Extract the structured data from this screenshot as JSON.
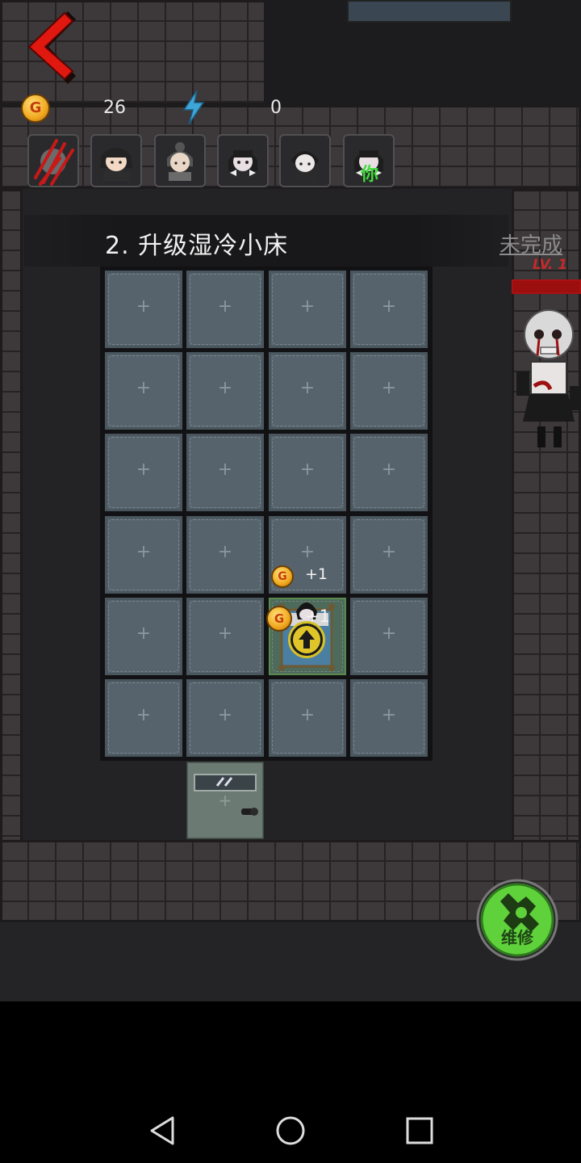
{
  "hud": {
    "coins": "26",
    "energy": "0",
    "coin_symbol": "G"
  },
  "characters": [
    {
      "name": "claw-marks-icon"
    },
    {
      "name": "girl-pigtails-icon"
    },
    {
      "name": "girl-bun-icon"
    },
    {
      "name": "girl-bow-icon"
    },
    {
      "name": "boy-icon"
    },
    {
      "name": "player-you-icon",
      "label": "你"
    }
  ],
  "task": {
    "title": "2. 升级湿冷小床",
    "status": "未完成"
  },
  "enemy": {
    "level": "LV. 1",
    "hp_fraction": 1.0
  },
  "room": {
    "cell_plus": "+",
    "floating_rewards": [
      {
        "coin": "G",
        "text": "+1"
      },
      {
        "coin": "G",
        "text": "+1"
      }
    ]
  },
  "repair": {
    "label": "维修"
  },
  "colors": {
    "accent_red": "#c42a2a",
    "repair_green": "#5fd13a",
    "coin_gold": "#f0a81e",
    "energy_blue": "#3fa4d6"
  },
  "system_nav": [
    "back-icon",
    "home-icon",
    "recents-icon"
  ]
}
